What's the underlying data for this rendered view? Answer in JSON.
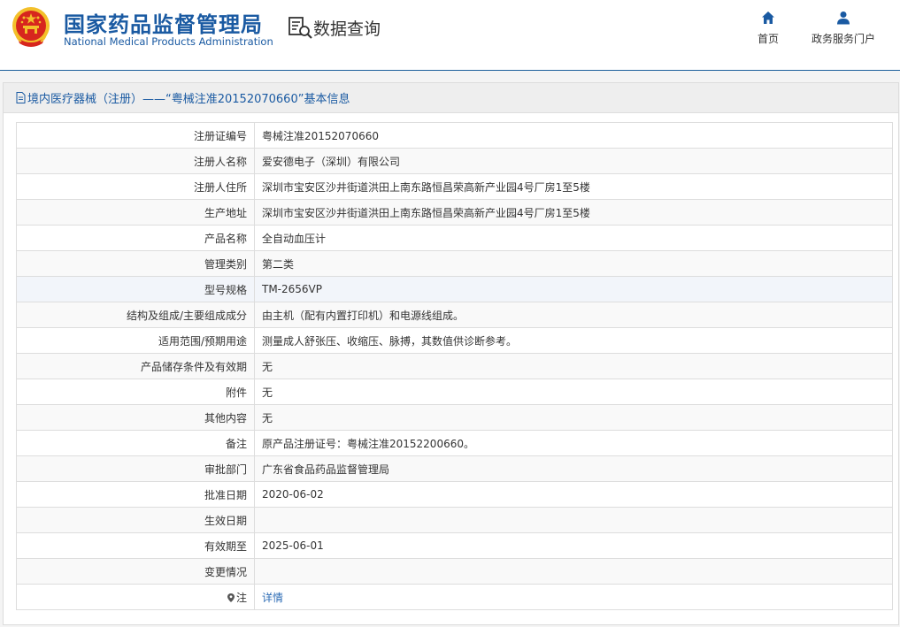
{
  "header": {
    "brand_cn": "国家药品监督管理局",
    "brand_en": "National Medical Products Administration",
    "query_label": "数据查询",
    "nav_home": "首页",
    "nav_portal": "政务服务门户"
  },
  "section_title": "境内医疗器械（注册）——“粤械注准20152070660”基本信息",
  "rows": [
    {
      "label": "注册证编号",
      "value": "粤械注准20152070660"
    },
    {
      "label": "注册人名称",
      "value": "爱安德电子（深圳）有限公司"
    },
    {
      "label": "注册人住所",
      "value": "深圳市宝安区沙井街道洪田上南东路恒昌荣高新产业园4号厂房1至5楼"
    },
    {
      "label": "生产地址",
      "value": "深圳市宝安区沙井街道洪田上南东路恒昌荣高新产业园4号厂房1至5楼"
    },
    {
      "label": "产品名称",
      "value": "全自动血压计"
    },
    {
      "label": "管理类别",
      "value": "第二类"
    },
    {
      "label": "型号规格",
      "value": "TM-2656VP"
    },
    {
      "label": "结构及组成/主要组成成分",
      "value": "由主机（配有内置打印机）和电源线组成。"
    },
    {
      "label": "适用范围/预期用途",
      "value": "测量成人舒张压、收缩压、脉搏，其数值供诊断参考。"
    },
    {
      "label": "产品储存条件及有效期",
      "value": "无"
    },
    {
      "label": "附件",
      "value": "无"
    },
    {
      "label": "其他内容",
      "value": "无"
    },
    {
      "label": "备注",
      "value": "原产品注册证号：粤械注准20152200660。"
    },
    {
      "label": "审批部门",
      "value": "广东省食品药品监督管理局"
    },
    {
      "label": "批准日期",
      "value": "2020-06-02"
    },
    {
      "label": "生效日期",
      "value": ""
    },
    {
      "label": "有效期至",
      "value": "2025-06-01"
    },
    {
      "label": "变更情况",
      "value": ""
    }
  ],
  "note": {
    "label": "注",
    "link": "详情"
  },
  "colors": {
    "brand_blue": "#1a5aa2",
    "link_blue": "#2d6cb5",
    "emblem_red": "#d7261e",
    "emblem_gold": "#f3c02b"
  },
  "icons": {
    "emblem": "national-emblem-icon",
    "query": "document-search-icon",
    "home": "home-icon",
    "portal": "user-icon",
    "title": "document-icon",
    "note": "pin-icon"
  }
}
